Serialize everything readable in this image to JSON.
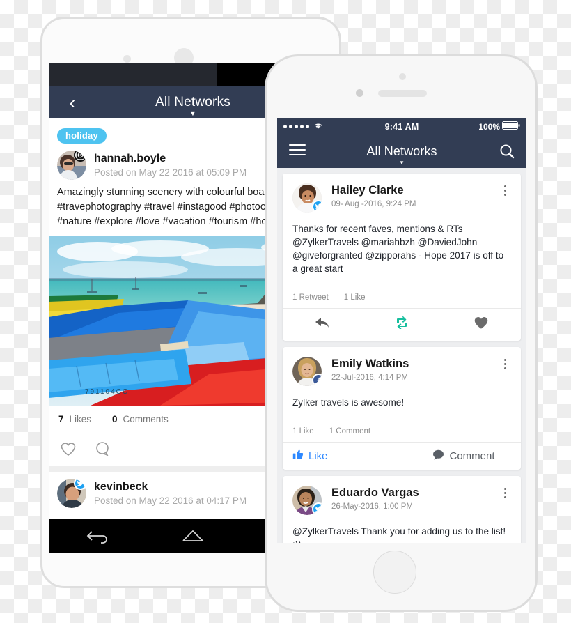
{
  "meta": {
    "accent_navbar": "#323d54",
    "tag_color": "#4ec3f0",
    "twitter_blue": "#1da1f2",
    "facebook_blue": "#3b5998",
    "retweet_teal": "#17bf9e",
    "like_blue": "#2d88ff"
  },
  "android_phone": {
    "status_bar": {
      "wifi_icon": "wifi-icon",
      "battery_icon": "battery-icon"
    },
    "nav": {
      "back_icon": "back-chevron-icon",
      "title": "All Networks",
      "caret": "▼"
    },
    "post": {
      "tag": "holiday",
      "author": "hannah.boyle",
      "badge": "instagram-badge-icon",
      "date": "Posted on May 22 2016 at 05:09 PM",
      "text_line_1": "Amazingly stunning scenery with colourful boats...",
      "text_line_2": "#travephotography #travel #instagood #photoofth",
      "text_line_3": "#nature #explore #love #vacation #tourism #holid",
      "photo_alt": "colourful-boats-beach-photo",
      "photo_hull_number": "791104CC",
      "likes_count": "7",
      "likes_label": "Likes",
      "comments_count": "0",
      "comments_label": "Comments",
      "like_icon": "heart-outline-icon",
      "comment_icon": "comment-outline-icon"
    },
    "post2": {
      "author": "kevinbeck",
      "badge": "twitter-badge-icon",
      "date": "Posted on May 22 2016 at 04:17 PM"
    },
    "bottom_nav": {
      "back_icon": "android-back-icon",
      "home_icon": "android-home-icon",
      "recents_icon": "android-recents-icon"
    }
  },
  "ios_phone": {
    "status_bar": {
      "signal_icon": "signal-dots-icon",
      "wifi_icon": "wifi-icon",
      "time": "9:41 AM",
      "battery_percent": "100%",
      "battery_icon": "battery-icon"
    },
    "nav": {
      "menu_icon": "hamburger-menu-icon",
      "title": "All Networks",
      "caret": "▼",
      "search_icon": "search-icon"
    },
    "cards": [
      {
        "author": "Hailey Clarke",
        "network": "twitter",
        "badge": "twitter-badge-icon",
        "date": "09- Aug -2016, 9:24 PM",
        "body": "Thanks for recent faves, mentions & RTs @ZylkerTravels @mariahbzh @DaviedJohn @giveforgranted @zipporahs - Hope 2017 is off to a great start",
        "counts": [
          "1 Retweet",
          "1 Like"
        ],
        "actions": [
          {
            "icon": "reply-icon",
            "label": ""
          },
          {
            "icon": "retweet-icon",
            "label": ""
          },
          {
            "icon": "heart-filled-icon",
            "label": ""
          }
        ],
        "menu_icon": "kebab-menu-icon"
      },
      {
        "author": "Emily Watkins",
        "network": "facebook",
        "badge": "facebook-badge-icon",
        "date": "22-Jul-2016, 4:14 PM",
        "body": "Zylker travels is awesome!",
        "counts": [
          "1 Like",
          "1 Comment"
        ],
        "fb_actions": [
          {
            "icon": "thumbs-up-icon",
            "label": "Like"
          },
          {
            "icon": "comment-bubble-icon",
            "label": "Comment"
          }
        ],
        "menu_icon": "kebab-menu-icon"
      },
      {
        "author": "Eduardo Vargas",
        "network": "twitter",
        "badge": "twitter-badge-icon",
        "date": "26-May-2016, 1:00 PM",
        "body": "@ZylkerTravels Thank you for adding us to the list! :))",
        "menu_icon": "kebab-menu-icon"
      }
    ]
  }
}
